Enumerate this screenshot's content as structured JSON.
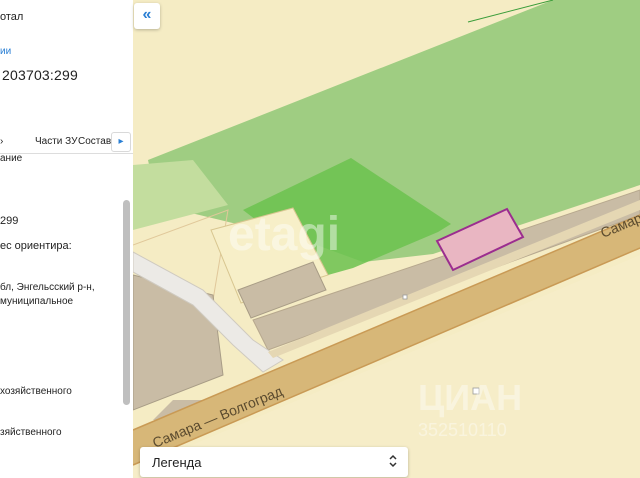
{
  "panel": {
    "portal_text": "отал",
    "link_text": "ии",
    "cadastral_number": "203703:299",
    "tabs": [
      "Части ЗУ",
      "Состав"
    ],
    "tab_arrow": "▸",
    "fields": [
      "ание",
      "299",
      "ес ориентира:",
      "бл, Энгельсский р-н,",
      "муниципальное",
      "хозяйственного",
      "зяйственного"
    ]
  },
  "map": {
    "collapse_icon": "«",
    "road_label_main": "Самара — Волгоград",
    "road_label_right": "Самар",
    "watermark_center": "etagi",
    "watermark_bottom": "ЦИАН",
    "watermark_phone": "352510110",
    "colors": {
      "background": "#f5ecc4",
      "green_parcel": "#9fcd82",
      "highlight_parcel": "#e9b6c2",
      "highlight_border": "#9b2d8f",
      "building": "#c9bca5",
      "road": "#d7b778",
      "road_edge": "#c99a55"
    }
  },
  "legend": {
    "label": "Легенда",
    "toggle_icon": "⌃⌄"
  }
}
